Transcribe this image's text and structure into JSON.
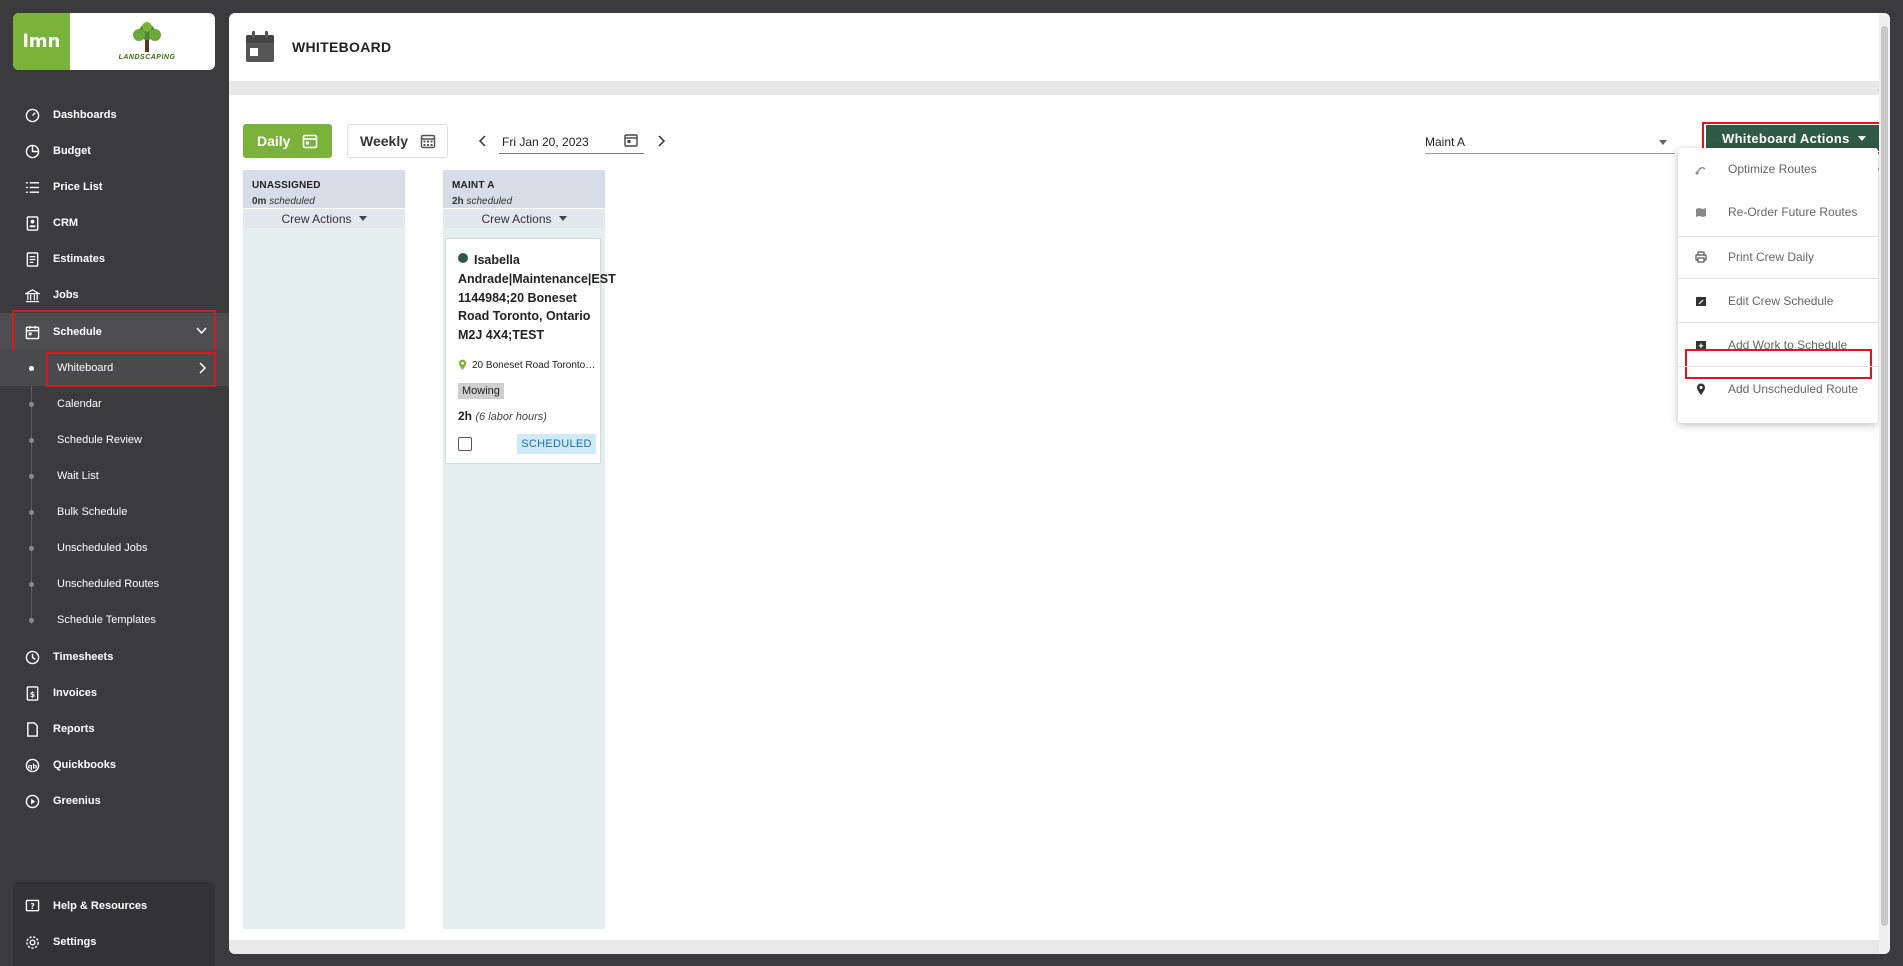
{
  "brand": {
    "lmn_logo_text": "lmn",
    "company_logo_text": "LANDSCAPING",
    "accent_green": "#7bb23a",
    "dark_green": "#2f5a45",
    "highlight_red": "#e0141e"
  },
  "sidebar": {
    "items": [
      {
        "label": "Dashboards",
        "icon": "dashboard-gauge-icon"
      },
      {
        "label": "Budget",
        "icon": "budget-pie-icon"
      },
      {
        "label": "Price List",
        "icon": "list-icon"
      },
      {
        "label": "CRM",
        "icon": "crm-contact-icon"
      },
      {
        "label": "Estimates",
        "icon": "estimate-document-icon"
      },
      {
        "label": "Jobs",
        "icon": "jobs-building-icon"
      },
      {
        "label": "Schedule",
        "icon": "schedule-calendar-icon"
      }
    ],
    "schedule_subitems": [
      "Whiteboard",
      "Calendar",
      "Schedule Review",
      "Wait List",
      "Bulk Schedule",
      "Unscheduled Jobs",
      "Unscheduled Routes",
      "Schedule Templates"
    ],
    "items_after": [
      {
        "label": "Timesheets",
        "icon": "clock-icon"
      },
      {
        "label": "Invoices",
        "icon": "invoice-icon"
      },
      {
        "label": "Reports",
        "icon": "report-icon"
      },
      {
        "label": "Quickbooks",
        "icon": "quickbooks-icon"
      },
      {
        "label": "Greenius",
        "icon": "play-circle-icon"
      }
    ],
    "bottom": [
      {
        "label": "Help & Resources",
        "icon": "help-icon"
      },
      {
        "label": "Settings",
        "icon": "gear-icon"
      }
    ]
  },
  "header": {
    "title": "WHITEBOARD"
  },
  "toolbar": {
    "daily_label": "Daily",
    "weekly_label": "Weekly",
    "date_value": "Fri Jan 20, 2023",
    "crew_select_value": "Maint A",
    "whiteboard_actions_label": "Whiteboard Actions"
  },
  "whiteboard_menu": {
    "items": [
      {
        "label": "Optimize Routes",
        "icon": "optimize-route-icon"
      },
      {
        "label": "Re-Order Future Routes",
        "icon": "map-icon"
      },
      {
        "label": "Print Crew Daily",
        "icon": "printer-icon"
      },
      {
        "label": "Edit Crew Schedule",
        "icon": "edit-calendar-icon"
      },
      {
        "label": "Add Work to Schedule",
        "icon": "add-calendar-icon"
      },
      {
        "label": "Add Unscheduled Route",
        "icon": "map-pin-icon"
      }
    ]
  },
  "columns": [
    {
      "name": "UNASSIGNED",
      "time": "0m",
      "time_label": "scheduled",
      "crew_actions_label": "Crew Actions"
    },
    {
      "name": "MAINT A",
      "time": "2h",
      "time_label": "scheduled",
      "crew_actions_label": "Crew Actions"
    }
  ],
  "job_card": {
    "title": "Isabella Andrade|Maintenance|EST 1144984;20 Boneset Road Toronto, Ontario M2J 4X4;TEST",
    "address": "20 Boneset Road Toronto, ...",
    "tag": "Mowing",
    "hours": "2h",
    "labor_hours": "(6 labor hours)",
    "status": "SCHEDULED"
  }
}
